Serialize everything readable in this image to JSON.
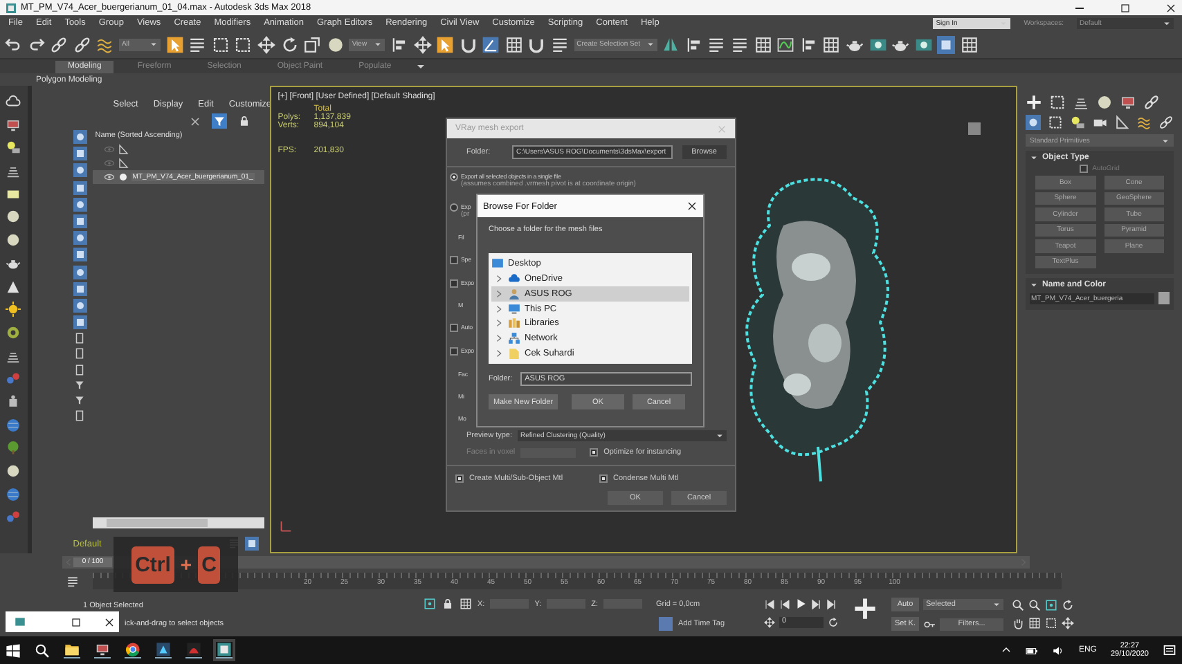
{
  "window": {
    "title": "MT_PM_V74_Acer_buergerianum_01_04.max - Autodesk 3ds Max 2018"
  },
  "menu": [
    "File",
    "Edit",
    "Tools",
    "Group",
    "Views",
    "Create",
    "Modifiers",
    "Animation",
    "Graph Editors",
    "Rendering",
    "Civil View",
    "Customize",
    "Scripting",
    "Content",
    "Help"
  ],
  "account": {
    "sign_in": "Sign In",
    "workspaces_label": "Workspaces:",
    "workspace": "Default"
  },
  "toolbar": {
    "selection_filter": "All",
    "reference_coord": "View",
    "selection_set": "Create Selection Set"
  },
  "ribbon": {
    "tabs": [
      {
        "label": "Modeling",
        "selected": true
      },
      {
        "label": "Freeform",
        "selected": false
      },
      {
        "label": "Selection",
        "selected": false
      },
      {
        "label": "Object Paint",
        "selected": false
      },
      {
        "label": "Populate",
        "selected": false
      }
    ],
    "panel": "Polygon Modeling"
  },
  "scene_explorer": {
    "menu": [
      "Select",
      "Display",
      "Edit",
      "Customize"
    ],
    "column": "Name (Sorted Ascending)",
    "rows": [
      {
        "kind": "layer",
        "selected": false
      },
      {
        "kind": "layer",
        "selected": false
      },
      {
        "kind": "object",
        "name": "MT_PM_V74_Acer_buergerianum_01_",
        "selected": true
      }
    ],
    "layer": "Default"
  },
  "viewport": {
    "label": "[+] [Front] [User Defined] [Default Shading]",
    "stats_header": "Total",
    "stats": [
      {
        "label": "Polys:",
        "value": "1,137,839"
      },
      {
        "label": "Verts:",
        "value": "894,104"
      },
      {
        "label": "FPS:",
        "value": "201,830"
      }
    ]
  },
  "command_panel": {
    "category": "Standard Primitives",
    "object_type": "Object Type",
    "autogrid": {
      "label": "AutoGrid",
      "checked": false
    },
    "primitives": [
      "Box",
      "Cone",
      "Sphere",
      "GeoSphere",
      "Cylinder",
      "Tube",
      "Torus",
      "Pyramid",
      "Teapot",
      "Plane",
      "TextPlus"
    ],
    "name_and_color": "Name and Color",
    "object_name": "MT_PM_V74_Acer_buergeria"
  },
  "vray_export": {
    "title": "VRay mesh export",
    "folder_label": "Folder:",
    "folder": "C:\\Users\\ASUS ROG\\Documents\\3dsMax\\export",
    "browse": "Browse",
    "options": [
      {
        "kind": "radio",
        "label": "Export all selected objects in a single file",
        "note": "(assumes combined .vrmesh pivot is at coordinate origin)",
        "selected": true
      },
      {
        "kind": "radio",
        "label": "Exp",
        "note": "(pr",
        "selected": false
      },
      {
        "kind": "text",
        "label": "Fil"
      },
      {
        "kind": "check",
        "label": "Spe",
        "checked": false
      },
      {
        "kind": "check",
        "label": "Expo",
        "checked": false
      },
      {
        "kind": "text",
        "label": "M"
      },
      {
        "kind": "check",
        "label": "Auto",
        "checked": false
      },
      {
        "kind": "check",
        "label": "Expo",
        "checked": false
      },
      {
        "kind": "text",
        "label": "Fac"
      },
      {
        "kind": "text",
        "label": "Mi"
      },
      {
        "kind": "text",
        "label": "Mo"
      }
    ],
    "preview_label": "Preview type:",
    "preview": "Refined Clustering (Quality)",
    "faces_label": "Faces in voxel",
    "faces_disabled": true,
    "optimize": {
      "label": "Optimize for instancing",
      "checked": true
    },
    "multi_sub": {
      "label": "Create Multi/Sub-Object Mtl",
      "checked": true
    },
    "condense": {
      "label": "Condense Multi Mtl",
      "checked": true
    },
    "buttons": [
      "OK",
      "Cancel"
    ]
  },
  "browse_folder": {
    "title": "Browse For Folder",
    "prompt": "Choose a folder for the mesh files",
    "tree": {
      "name": "Desktop",
      "kind": "desktop",
      "expanded": true,
      "selected": false,
      "children": [
        {
          "name": "OneDrive",
          "kind": "cloud",
          "expanded": false,
          "selected": false
        },
        {
          "name": "ASUS ROG",
          "kind": "user",
          "expanded": false,
          "selected": true
        },
        {
          "name": "This PC",
          "kind": "pc",
          "expanded": false,
          "selected": false
        },
        {
          "name": "Libraries",
          "kind": "folder",
          "expanded": false,
          "selected": false
        },
        {
          "name": "Network",
          "kind": "network",
          "expanded": false,
          "selected": false
        },
        {
          "name": "Cek Suhardi",
          "kind": "folder",
          "expanded": false,
          "selected": false
        }
      ]
    },
    "folder_label": "Folder:",
    "folder": "ASUS ROG",
    "buttons": [
      "Make New Folder",
      "OK",
      "Cancel"
    ]
  },
  "timeline": {
    "slider": "0 / 100",
    "level": 0,
    "ticks": [
      "20",
      "25",
      "30",
      "35",
      "40",
      "45",
      "50",
      "55",
      "60",
      "65",
      "70",
      "75",
      "80",
      "85",
      "90",
      "95",
      "100"
    ]
  },
  "status": {
    "selection": "1 Object Selected",
    "prompt": "ick-and-drag to select objects",
    "x_label": "X:",
    "y_label": "Y:",
    "z_label": "Z:",
    "grid": "Grid = 0,0cm",
    "time_tag": "Add Time Tag",
    "frame": "0",
    "auto_key": "Auto",
    "key_filter": "Selected",
    "set_key": "Set K.",
    "filters": "Filters..."
  },
  "key_overlay": {
    "keys": [
      "Ctrl",
      "C"
    ],
    "joiner": "+"
  },
  "taskbar": {
    "language": "ENG",
    "time": "22:27",
    "date": "29/10/2020"
  }
}
